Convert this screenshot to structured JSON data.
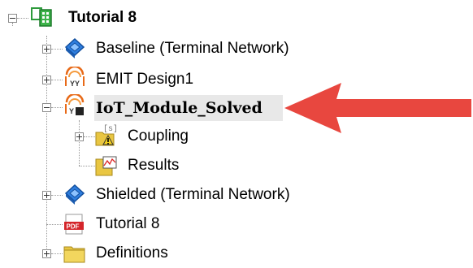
{
  "tree": {
    "root": {
      "label": "Tutorial 8",
      "icon": "project-icon",
      "expanded": true
    },
    "items": [
      {
        "label": "Baseline (Terminal Network)",
        "icon": "hfss-design-icon",
        "expanded": false
      },
      {
        "label": "EMIT Design1",
        "icon": "emit-design-icon",
        "expanded": false
      },
      {
        "label": "IoT_Module_Solved",
        "icon": "emit-design-icon",
        "expanded": true,
        "selected": true,
        "children": [
          {
            "label": "Coupling",
            "icon": "coupling-folder-icon",
            "expanded": false
          },
          {
            "label": "Results",
            "icon": "results-folder-icon"
          }
        ]
      },
      {
        "label": "Shielded (Terminal Network)",
        "icon": "hfss-design-icon",
        "expanded": false
      },
      {
        "label": "Tutorial 8",
        "icon": "pdf-icon"
      },
      {
        "label": "Definitions",
        "icon": "folder-icon",
        "expanded": false
      }
    ]
  },
  "colors": {
    "arrow": "#e8473f",
    "selection": "#e8e8e8",
    "project_icon": "#2e9b3c",
    "hfss_icon": "#1f6fd1",
    "emit_icon": "#e86a18",
    "pdf_icon": "#d4252a",
    "folder": "#e9c642"
  }
}
